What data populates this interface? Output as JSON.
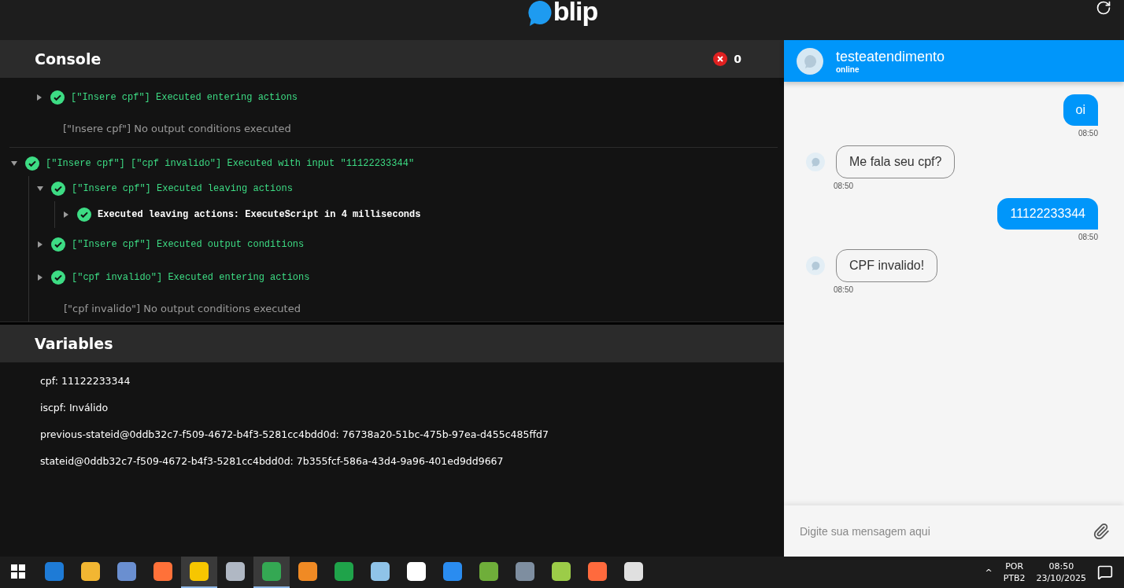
{
  "topbar": {
    "logo": "blip"
  },
  "console": {
    "title": "Console",
    "error_count": "0",
    "groups": [
      {
        "entries": [
          {
            "kind": "node",
            "expanded": false,
            "text": "[\"Insere cpf\"] Executed entering actions"
          },
          {
            "kind": "note",
            "text": "[\"Insere cpf\"] No output conditions executed"
          }
        ]
      },
      {
        "entries": [
          {
            "kind": "node",
            "expanded": true,
            "text": "[\"Insere cpf\"] [\"cpf invalido\"] Executed with input \"11122233344\"",
            "children": [
              {
                "kind": "node",
                "expanded": true,
                "text": "[\"Insere cpf\"] Executed leaving actions",
                "children": [
                  {
                    "kind": "detail",
                    "expanded": false,
                    "text": "Executed leaving actions: ExecuteScript in 4 milliseconds"
                  }
                ]
              },
              {
                "kind": "node",
                "expanded": false,
                "text": "[\"Insere cpf\"] Executed output conditions"
              },
              {
                "kind": "node",
                "expanded": false,
                "text": "[\"cpf invalido\"] Executed entering actions"
              },
              {
                "kind": "note",
                "text": "[\"cpf invalido\"] No output conditions executed"
              }
            ]
          }
        ]
      }
    ]
  },
  "variables": {
    "title": "Variables",
    "items": [
      "cpf: 11122233344",
      "iscpf: Inválido",
      "previous-stateid@0ddb32c7-f509-4672-b4f3-5281cc4bdd0d: 76738a20-51bc-475b-97ea-d455c485ffd7",
      "stateid@0ddb32c7-f509-4672-b4f3-5281cc4bdd0d: 7b355fcf-586a-43d4-9a96-401ed9dd9667"
    ]
  },
  "chat": {
    "contact": "testeatendimento",
    "status": "online",
    "messages": [
      {
        "kind": "sent",
        "text": "oi",
        "time": "08:50"
      },
      {
        "kind": "received",
        "text": "Me fala seu cpf?",
        "time": "08:50"
      },
      {
        "kind": "sent",
        "text": "11122233344",
        "time": "08:50"
      },
      {
        "kind": "received",
        "text": "CPF invalido!",
        "time": "08:50"
      }
    ],
    "input": {
      "placeholder": "Digite sua mensagem aqui"
    }
  },
  "taskbar": {
    "apps": [
      {
        "color": "#1e7bd6",
        "selected": false
      },
      {
        "color": "#f2b632",
        "selected": false
      },
      {
        "color": "#6a8fd0",
        "selected": false
      },
      {
        "color": "#ff7139",
        "selected": false
      },
      {
        "color": "#f7c600",
        "selected": true
      },
      {
        "color": "#b0b8c4",
        "selected": false
      },
      {
        "color": "#34a853",
        "selected": true
      },
      {
        "color": "#f08a24",
        "selected": false
      },
      {
        "color": "#1fa34a",
        "selected": false
      },
      {
        "color": "#8fc3e8",
        "selected": false
      },
      {
        "color": "#ffffff",
        "selected": false
      },
      {
        "color": "#2a8cf0",
        "selected": false
      },
      {
        "color": "#6fae3a",
        "selected": false
      },
      {
        "color": "#7e8ea0",
        "selected": false
      },
      {
        "color": "#9ccc48",
        "selected": false
      },
      {
        "color": "#ff6a3d",
        "selected": false
      },
      {
        "color": "#e0e0e0",
        "selected": false
      }
    ],
    "tray": {
      "arrow": "^",
      "lang_top": "POR",
      "lang_bottom": "PTB2",
      "time": "08:50",
      "date": "23/10/2025"
    }
  }
}
